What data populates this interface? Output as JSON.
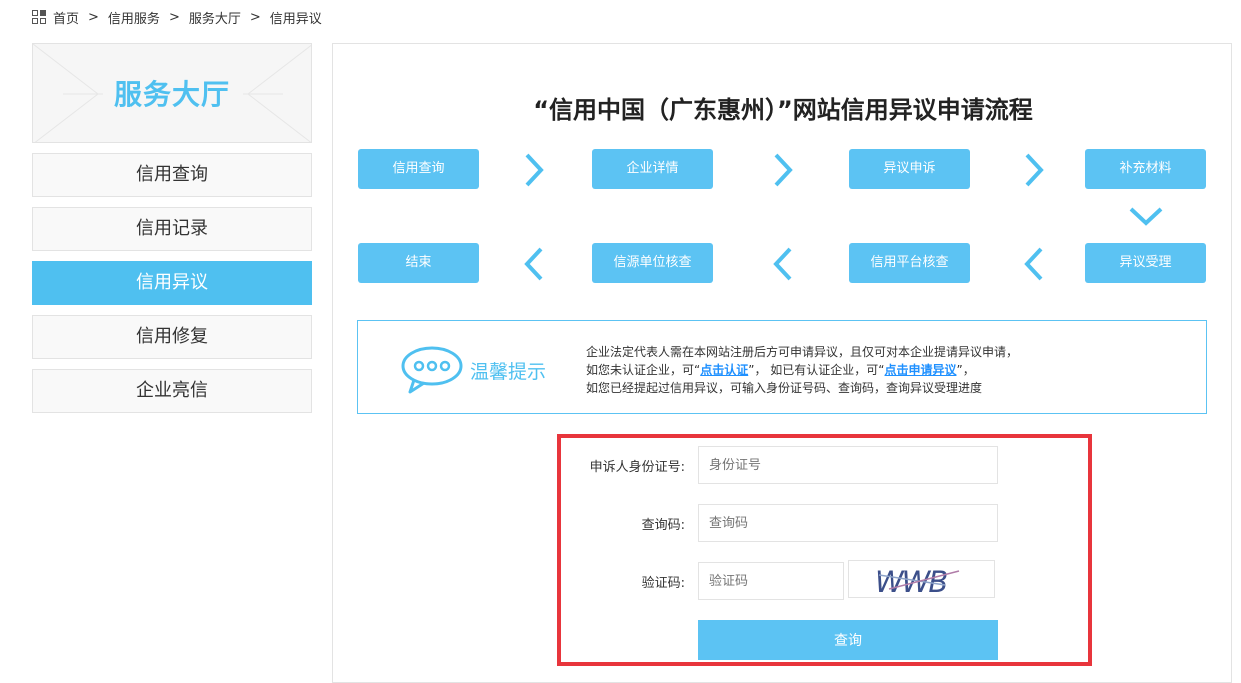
{
  "breadcrumb": {
    "items": [
      "首页",
      "信用服务",
      "服务大厅",
      "信用异议"
    ],
    "separator": ">"
  },
  "sidebar": {
    "title": "服务大厅",
    "items": [
      {
        "label": "信用查询",
        "active": false
      },
      {
        "label": "信用记录",
        "active": false
      },
      {
        "label": "信用异议",
        "active": true
      },
      {
        "label": "信用修复",
        "active": false
      },
      {
        "label": "企业亮信",
        "active": false
      }
    ]
  },
  "main": {
    "title": "“信用中国（广东惠州）”网站信用异议申请流程",
    "flow_row1": [
      "信用查询",
      "企业详情",
      "异议申诉",
      "补充材料"
    ],
    "flow_row2": [
      "结束",
      "信源单位核查",
      "信用平台核查",
      "异议受理"
    ]
  },
  "tip": {
    "label": "温馨提示",
    "line1": "企业法定代表人需在本网站注册后方可申请异议，且仅可对本企业提请异议申请，",
    "line2_a": "如您未认证企业，可“",
    "line2_link1": "点击认证",
    "line2_b": "”， 如已有认证企业，可“",
    "line2_link2": "点击申请异议",
    "line2_c": "”，",
    "line3": "如您已经提起过信用异议，可输入身份证号码、查询码，查询异议受理进度"
  },
  "form": {
    "id_label": "申诉人身份证号:",
    "id_placeholder": "身份证号",
    "query_code_label": "查询码:",
    "query_code_placeholder": "查询码",
    "captcha_label": "验证码:",
    "captcha_placeholder": "验证码",
    "captcha_text": "WWB",
    "submit_label": "查询"
  },
  "colors": {
    "accent": "#5cc3f3",
    "highlight_border": "#e8353c"
  }
}
